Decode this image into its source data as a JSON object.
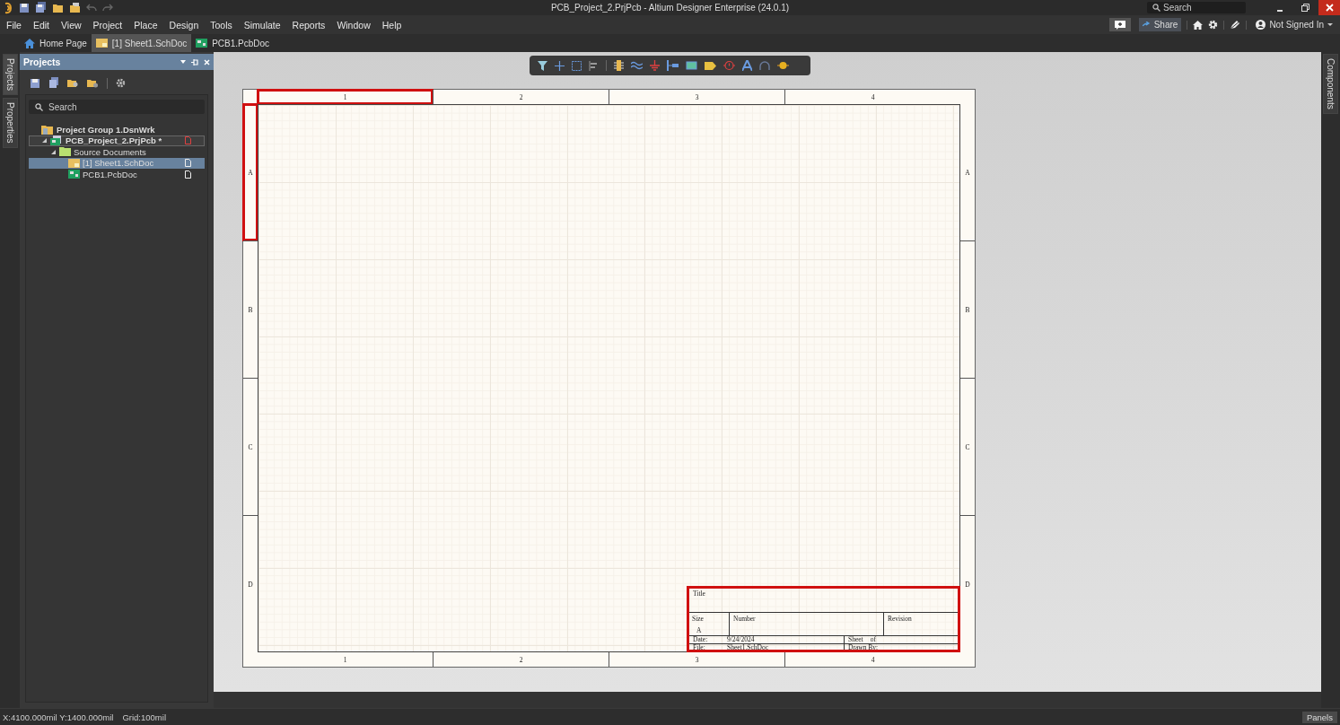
{
  "window": {
    "title": "PCB_Project_2.PrjPcb - Altium Designer Enterprise (24.0.1)",
    "search": {
      "placeholder": "Search"
    }
  },
  "menu": [
    "File",
    "Edit",
    "View",
    "Project",
    "Place",
    "Design",
    "Tools",
    "Simulate",
    "Reports",
    "Window",
    "Help"
  ],
  "header": {
    "share": "Share",
    "account": "Not Signed In"
  },
  "doc_tabs": [
    {
      "label": "Home Page",
      "kind": "home",
      "selected": false
    },
    {
      "label": "[1] Sheet1.SchDoc",
      "kind": "sch",
      "selected": true
    },
    {
      "label": "PCB1.PcbDoc",
      "kind": "pcb",
      "selected": false
    }
  ],
  "left_side_tabs": [
    {
      "label": "Projects",
      "selected": true
    },
    {
      "label": "Properties",
      "selected": false
    }
  ],
  "right_side_tabs": [
    {
      "label": "Components",
      "selected": false
    }
  ],
  "projects_panel": {
    "title": "Projects",
    "search": {
      "placeholder": "Search"
    },
    "tree": [
      {
        "label": "Project Group 1.DsnWrk",
        "kind": "group",
        "selected": false,
        "children": [
          {
            "label": "PCB_Project_2.PrjPcb *",
            "kind": "project",
            "selected": false,
            "modified": true,
            "expanded": true,
            "children": [
              {
                "label": "Source Documents",
                "kind": "folder",
                "selected": false,
                "expanded": true,
                "children": [
                  {
                    "label": "[1] Sheet1.SchDoc",
                    "kind": "sch",
                    "selected": true,
                    "modified": false
                  },
                  {
                    "label": "PCB1.PcbDoc",
                    "kind": "pcb",
                    "selected": false,
                    "modified": false
                  }
                ]
              }
            ]
          }
        ]
      }
    ]
  },
  "sheet": {
    "top_zones": [
      {
        "label": "1",
        "highlighted": true
      },
      {
        "label": "2",
        "highlighted": false
      },
      {
        "label": "3",
        "highlighted": false
      },
      {
        "label": "4",
        "highlighted": false
      }
    ],
    "bottom_zones": [
      {
        "label": "1",
        "highlighted": false
      },
      {
        "label": "2",
        "highlighted": false
      },
      {
        "label": "3",
        "highlighted": false
      },
      {
        "label": "4",
        "highlighted": false
      }
    ],
    "left_zones": [
      {
        "label": "A",
        "highlighted": true
      },
      {
        "label": "B",
        "highlighted": false
      },
      {
        "label": "C",
        "highlighted": false
      },
      {
        "label": "D",
        "highlighted": false
      }
    ],
    "right_zones": [
      {
        "label": "A",
        "highlighted": false
      },
      {
        "label": "B",
        "highlighted": false
      },
      {
        "label": "C",
        "highlighted": false
      },
      {
        "label": "D",
        "highlighted": false
      }
    ],
    "title_block": {
      "highlighted": true,
      "title_label": "Title",
      "size_label": "Size",
      "size": "A",
      "number_label": "Number",
      "revision_label": "Revision",
      "date_label": "Date:",
      "date": "9/24/2024",
      "sheet_label": "Sheet",
      "of_label": "of",
      "file_label": "File:",
      "file": "Sheet1.SchDoc",
      "drawn_by_label": "Drawn By:"
    }
  },
  "status_bar": {
    "coordinates": "X:4100.000mil Y:1400.000mil",
    "grid": "Grid:100mil",
    "panels": "Panels"
  }
}
